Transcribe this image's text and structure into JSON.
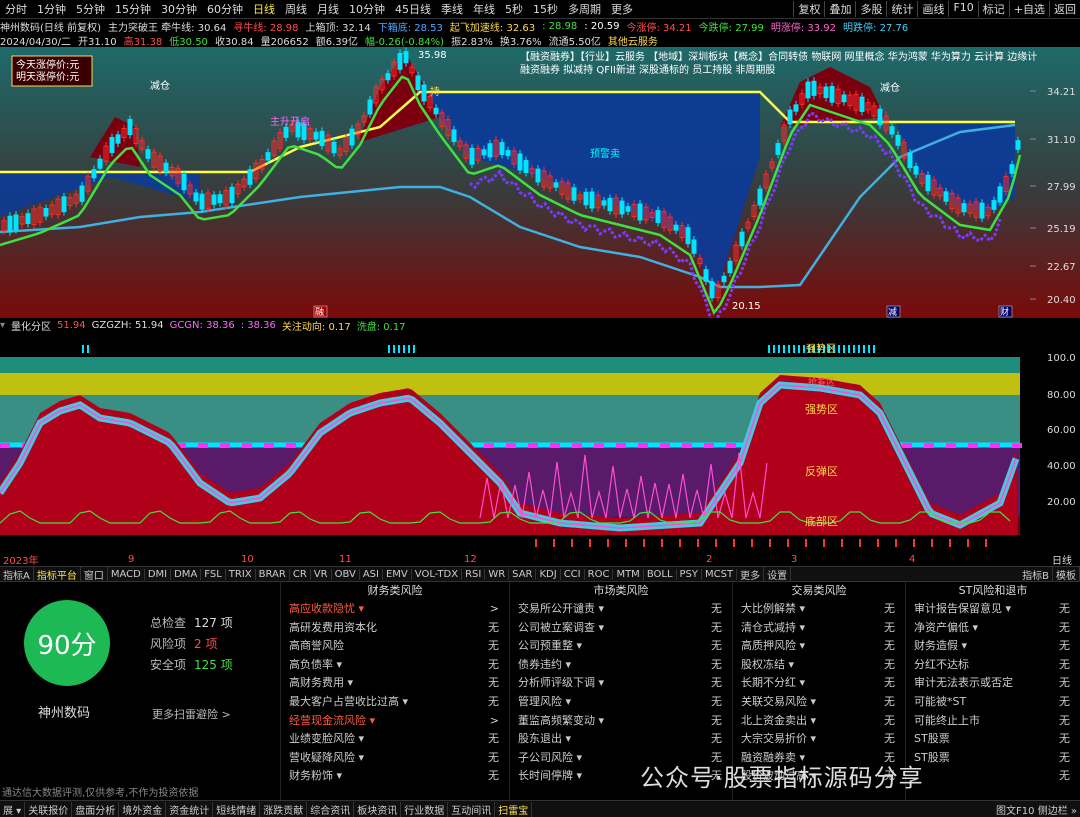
{
  "topbar": {
    "periods": [
      "分时",
      "1分钟",
      "5分钟",
      "15分钟",
      "30分钟",
      "60分钟",
      "日线",
      "周线",
      "月线",
      "10分钟",
      "45日线",
      "季线",
      "年线",
      "5秒",
      "15秒",
      "多周期",
      "更多"
    ],
    "active_period": "日线",
    "right": [
      "复权",
      "叠加",
      "多股",
      "统计",
      "画线",
      "F10",
      "标记",
      "+自选",
      "返回"
    ]
  },
  "line1": [
    {
      "t": "神州数码(日线 前复权)",
      "c": "#dddddd"
    },
    {
      "t": "主力突破王 牵牛线: 30.64",
      "c": "#dddddd"
    },
    {
      "t": "寻牛线: 28.98",
      "c": "#ff4d4d"
    },
    {
      "t": "上箱顶: 32.14",
      "c": "#dddddd"
    },
    {
      "t": "下箱底: 28.53",
      "c": "#4da6ff"
    },
    {
      "t": "起飞加速线: 32.63",
      "c": "#ffd84a"
    },
    {
      "t": ": 28.98",
      "c": "#40e040"
    },
    {
      "t": ": 20.59",
      "c": "#ffffff"
    },
    {
      "t": "今涨停: 34.21",
      "c": "#ff4d4d"
    },
    {
      "t": "今跌停: 27.99",
      "c": "#40e040"
    },
    {
      "t": "明涨停: 33.92",
      "c": "#ff66cc"
    },
    {
      "t": "明跌停: 27.76",
      "c": "#40d0ff"
    }
  ],
  "line2": [
    {
      "t": "2024/04/30/二",
      "c": "#dddddd"
    },
    {
      "t": "开31.10",
      "c": "#dddddd"
    },
    {
      "t": "高31.38",
      "c": "#ff4d4d"
    },
    {
      "t": "低30.50",
      "c": "#40e040"
    },
    {
      "t": "收30.84",
      "c": "#dddddd"
    },
    {
      "t": "量206652",
      "c": "#dddddd"
    },
    {
      "t": "额6.39亿",
      "c": "#dddddd"
    },
    {
      "t": "幅-0.26(-0.84%)",
      "c": "#40e040"
    },
    {
      "t": "振2.83%",
      "c": "#dddddd"
    },
    {
      "t": "换3.76%",
      "c": "#dddddd"
    },
    {
      "t": "流通5.50亿",
      "c": "#dddddd"
    },
    {
      "t": "其他云服务",
      "c": "#ffd84a"
    }
  ],
  "kchart": {
    "limit_box": [
      "今天涨停价:元",
      "明天涨停价:元"
    ],
    "price_axis": [
      "34.21",
      "31.10",
      "27.99",
      "25.19",
      "22.67",
      "20.40"
    ],
    "concept_line1": "【融资融券】【行业】云服务 【地域】深圳板块【概念】合同转债 物联网 网里概念 华为鸿蒙 华为算力 云计算 边缘计",
    "concept_line2": "融资融券 拟减持 QFII新进 深股通标的 员工持股 非周期股",
    "high_label": "35.98",
    "low_label": "20.15",
    "labels": [
      {
        "t": "减仓",
        "c": "#ffffff"
      },
      {
        "t": "预警卖",
        "c": "#00ffff"
      },
      {
        "t": "主升开启",
        "c": "#ff66ff"
      },
      {
        "t": "持",
        "c": "#ffd84a"
      }
    ],
    "markers": [
      "融",
      "减",
      "财"
    ]
  },
  "subhead": [
    {
      "t": "量化分区",
      "c": "#dddddd"
    },
    {
      "t": "51.94",
      "c": "#ff4d4d"
    },
    {
      "t": "GZGZH: 51.94",
      "c": "#dddddd"
    },
    {
      "t": "GCGN: 38.36",
      "c": "#ff66ff"
    },
    {
      "t": ": 38.36",
      "c": "#ff66ff"
    },
    {
      "t": "关注动向: 0.17",
      "c": "#ffd84a"
    },
    {
      "t": "洗盘: 0.17",
      "c": "#40e040"
    }
  ],
  "lowchart": {
    "axis": [
      "100.0",
      "80.00",
      "60.00",
      "40.00",
      "20.00"
    ],
    "zones": [
      "强势区",
      "反弹区",
      "底部区"
    ],
    "top_zone": "强势区",
    "hot_zone": "抢筹区"
  },
  "timeaxis": [
    "2023年",
    "9",
    "10",
    "11",
    "12",
    "2",
    "3",
    "4"
  ],
  "timeaxis_right": "日线",
  "tabs": [
    "指标A",
    "指标平台",
    "窗口",
    "MACD",
    "DMI",
    "DMA",
    "FSL",
    "TRIX",
    "BRAR",
    "CR",
    "VR",
    "OBV",
    "ASI",
    "EMV",
    "VOL-TDX",
    "RSI",
    "WR",
    "SAR",
    "KDJ",
    "CCI",
    "ROC",
    "MTM",
    "BOLL",
    "PSY",
    "MCST",
    "更多",
    "设置"
  ],
  "tabs_sel": "指标平台",
  "tabs_right": [
    "指标B",
    "模板"
  ],
  "risk": {
    "score": "90分",
    "company": "神州数码",
    "total_label": "总检查",
    "total": "127 项",
    "risk_label": "风险项",
    "risk": "2 项",
    "safe_label": "安全项",
    "safe": "125 项",
    "more": "更多扫雷避险 >",
    "disclaimer": "通达信大数据评测,仅供参考,不作为投资依据",
    "columns": [
      {
        "title": "财务类风险",
        "items": [
          {
            "n": "高应收款隐忧 ▾",
            "v": ">",
            "hl": true
          },
          {
            "n": "高研发费用资本化",
            "v": "无"
          },
          {
            "n": "高商誉风险",
            "v": "无"
          },
          {
            "n": "高负债率 ▾",
            "v": "无"
          },
          {
            "n": "高财务费用 ▾",
            "v": "无"
          },
          {
            "n": "最大客户占营收比过高 ▾",
            "v": "无"
          },
          {
            "n": "经营现金流风险 ▾",
            "v": ">",
            "hl": true
          },
          {
            "n": "业绩变脸风险 ▾",
            "v": "无"
          },
          {
            "n": "营收疑降风险 ▾",
            "v": "无"
          },
          {
            "n": "财务粉饰 ▾",
            "v": "无"
          }
        ]
      },
      {
        "title": "市场类风险",
        "items": [
          {
            "n": "交易所公开谴责 ▾",
            "v": "无"
          },
          {
            "n": "公司被立案调查 ▾",
            "v": "无"
          },
          {
            "n": "公司预重整 ▾",
            "v": "无"
          },
          {
            "n": "债券违约 ▾",
            "v": "无"
          },
          {
            "n": "分析师评级下调 ▾",
            "v": "无"
          },
          {
            "n": "管理风险 ▾",
            "v": "无"
          },
          {
            "n": "董监高频繁变动 ▾",
            "v": "无"
          },
          {
            "n": "股东退出 ▾",
            "v": "无"
          },
          {
            "n": "子公司风险 ▾",
            "v": "无"
          },
          {
            "n": "长时间停牌 ▾",
            "v": "无"
          }
        ]
      },
      {
        "title": "交易类风险",
        "items": [
          {
            "n": "大比例解禁 ▾",
            "v": "无"
          },
          {
            "n": "清仓式减持 ▾",
            "v": "无"
          },
          {
            "n": "高质押风险 ▾",
            "v": "无"
          },
          {
            "n": "股权冻结 ▾",
            "v": "无"
          },
          {
            "n": "长期不分红 ▾",
            "v": "无"
          },
          {
            "n": "关联交易风险 ▾",
            "v": "无"
          },
          {
            "n": "北上资金卖出 ▾",
            "v": "无"
          },
          {
            "n": "大宗交易折价 ▾",
            "v": "无"
          },
          {
            "n": "融资融券卖 ▾",
            "v": "无"
          },
          {
            "n": "股价波动过高 ▾",
            "v": "无"
          }
        ]
      },
      {
        "title": "ST风险和退市",
        "items": [
          {
            "n": "审计报告保留意见 ▾",
            "v": "无"
          },
          {
            "n": "净资产偏低 ▾",
            "v": "无"
          },
          {
            "n": "财务造假 ▾",
            "v": "无"
          },
          {
            "n": "分红不达标",
            "v": "无"
          },
          {
            "n": "审计无法表示或否定",
            "v": "无"
          },
          {
            "n": "可能被*ST",
            "v": "无"
          },
          {
            "n": "可能终止上市",
            "v": "无"
          },
          {
            "n": "ST股票",
            "v": "无"
          },
          {
            "n": "ST股票",
            "v": "无"
          },
          {
            "n": "",
            "v": "无"
          }
        ]
      }
    ]
  },
  "bottombar": [
    "展 ▾",
    "关联报价",
    "盘面分析",
    "境外资金",
    "资金统计",
    "短线情绪",
    "涨跌贡献",
    "综合资讯",
    "板块资讯",
    "行业数据",
    "互动间讯",
    "扫雷宝"
  ],
  "bottombar_right": "图文F10 侧边栏 »",
  "watermark": "公众号·股票指标源码分享",
  "colors": {
    "up": "#ff2a2a",
    "down": "#00e5ff",
    "green_line": "#40e040",
    "yellow_line": "#ffff44",
    "blue_fill": "#0a3b9a",
    "red_fill": "#7a0010"
  }
}
